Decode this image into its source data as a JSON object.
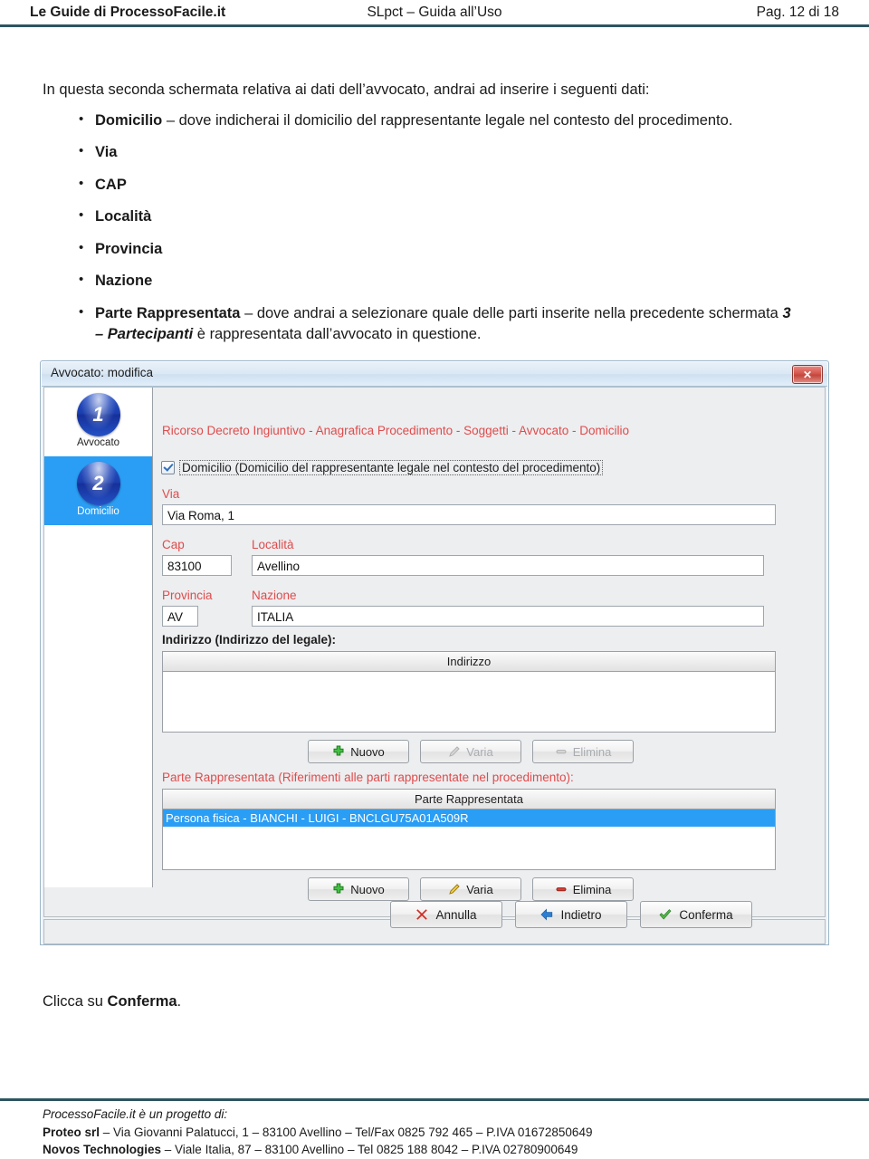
{
  "header": {
    "left": "Le Guide di ProcessoFacile.it",
    "center": "SLpct – Guida all’Uso",
    "right": "Pag. 12 di 18"
  },
  "content": {
    "intro": "In questa seconda schermata relativa ai dati dell’avvocato, andrai ad inserire i seguenti dati:",
    "bullets": [
      {
        "term": "Domicilio",
        "rest": " – dove indicherai il domicilio del rappresentante legale nel contesto del procedimento."
      },
      {
        "term": "Via",
        "rest": ""
      },
      {
        "term": "CAP",
        "rest": ""
      },
      {
        "term": "Località",
        "rest": ""
      },
      {
        "term": "Provincia",
        "rest": ""
      },
      {
        "term": "Nazione",
        "rest": ""
      }
    ],
    "last_bullet": {
      "term": "Parte Rappresentata",
      "part1": " – dove andrai a selezionare quale delle parti inserite nella precedente schermata ",
      "emph": "3 – Partecipanti",
      "part2": " è rappresentata dall’avvocato in questione."
    },
    "closing_prefix": "Clicca su ",
    "closing_bold": "Conferma",
    "closing_suffix": "."
  },
  "dialog": {
    "title": "Avvocato: modifica",
    "close_label": "✕",
    "steps": [
      {
        "number": "1",
        "label": "Avvocato",
        "active": false
      },
      {
        "number": "2",
        "label": "Domicilio",
        "active": true
      }
    ],
    "breadcrumb": "Ricorso Decreto Ingiuntivo - Anagrafica Procedimento - Soggetti - Avvocato - Domicilio",
    "checkbox": {
      "label": "Domicilio (Domicilio del rappresentante legale nel contesto del procedimento)",
      "checked": true
    },
    "fields": {
      "via_label": "Via",
      "via_value": "Via Roma, 1",
      "cap_label": "Cap",
      "cap_value": "83100",
      "localita_label": "Località",
      "localita_value": "Avellino",
      "provincia_label": "Provincia",
      "provincia_value": "AV",
      "nazione_label": "Nazione",
      "nazione_value": "ITALIA"
    },
    "indirizzo_section": {
      "title": "Indirizzo (Indirizzo del legale):",
      "column_header": "Indirizzo",
      "rows": [],
      "buttons": [
        {
          "label": "Nuovo",
          "icon": "plus-icon",
          "disabled": false
        },
        {
          "label": "Varia",
          "icon": "pencil-icon",
          "disabled": true
        },
        {
          "label": "Elimina",
          "icon": "minus-icon",
          "disabled": true
        }
      ]
    },
    "parte_section": {
      "title": "Parte Rappresentata (Riferimenti alle parti rappresentate nel procedimento):",
      "column_header": "Parte Rappresentata",
      "rows": [
        {
          "text": "Persona fisica - BIANCHI - LUIGI - BNCLGU75A01A509R",
          "selected": true
        }
      ],
      "buttons": [
        {
          "label": "Nuovo",
          "icon": "plus-icon",
          "disabled": false
        },
        {
          "label": "Varia",
          "icon": "pencil-icon",
          "disabled": false
        },
        {
          "label": "Elimina",
          "icon": "minus-icon",
          "disabled": false
        }
      ]
    },
    "actions": [
      {
        "label": "Annulla",
        "icon": "red-x-icon"
      },
      {
        "label": "Indietro",
        "icon": "blue-left-arrow-icon"
      },
      {
        "label": "Conferma",
        "icon": "green-check-icon"
      }
    ]
  },
  "footer": {
    "line1": "ProcessoFacile.it è un progetto di:",
    "line2_bold": "Proteo srl",
    "line2_rest": " – Via Giovanni Palatucci, 1 – 83100 Avellino – Tel/Fax 0825 792 465 – P.IVA 01672850649",
    "line3_bold": "Novos Technologies",
    "line3_rest": " – Viale Italia, 87 – 83100 Avellino – Tel 0825 188 8042 – P.IVA 02780900649"
  },
  "colors": {
    "rule": "#2c5560",
    "form_label_red": "#e04b4b",
    "selection_blue": "#2a9ef4"
  }
}
